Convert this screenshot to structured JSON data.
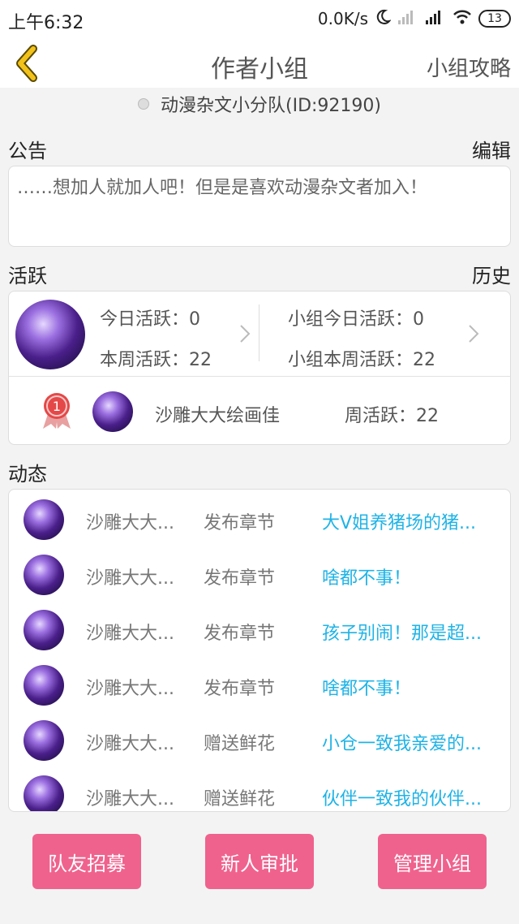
{
  "status": {
    "time": "上午6:32",
    "net_speed": "0.0K/s",
    "battery": "13",
    "moon_icon": "moon-icon",
    "signal_icon": "signal-icon",
    "wifi_icon": "wifi-icon"
  },
  "nav": {
    "back_icon": "chevron-left-icon",
    "title": "作者小组",
    "right_label": "小组攻略"
  },
  "group": {
    "name_line": "动漫杂文小分队(ID:92190)"
  },
  "notice": {
    "label": "公告",
    "edit_label": "编辑",
    "text": "……想加人就加人吧！但是是喜欢动漫杂文者加入！"
  },
  "activity": {
    "label": "活跃",
    "history_label": "历史",
    "today": "今日活跃：0",
    "week": "本周活跃：22",
    "group_today": "小组今日活跃：0",
    "group_week": "小组本周活跃：22",
    "rank": {
      "rank_number": "1",
      "name": "沙雕大大绘画佳",
      "weekly": "周活跃：22"
    }
  },
  "feed": {
    "label": "动态",
    "items": [
      {
        "user": "沙雕大大...",
        "action": "发布章节",
        "target": "大V姐养猪场的猪..."
      },
      {
        "user": "沙雕大大...",
        "action": "发布章节",
        "target": "啥都不事！"
      },
      {
        "user": "沙雕大大...",
        "action": "发布章节",
        "target": "孩子别闹！那是超..."
      },
      {
        "user": "沙雕大大...",
        "action": "发布章节",
        "target": "啥都不事！"
      },
      {
        "user": "沙雕大大...",
        "action": "赠送鲜花",
        "target": "小仓一致我亲爱的..."
      },
      {
        "user": "沙雕大大...",
        "action": "赠送鲜花",
        "target": "伙伴一致我的伙伴..."
      }
    ]
  },
  "buttons": {
    "recruit": "队友招募",
    "approve": "新人审批",
    "manage": "管理小组"
  },
  "colors": {
    "accent_pink": "#f0628e",
    "link_blue": "#1fb3e6",
    "back_yellow": "#f2c21a"
  }
}
